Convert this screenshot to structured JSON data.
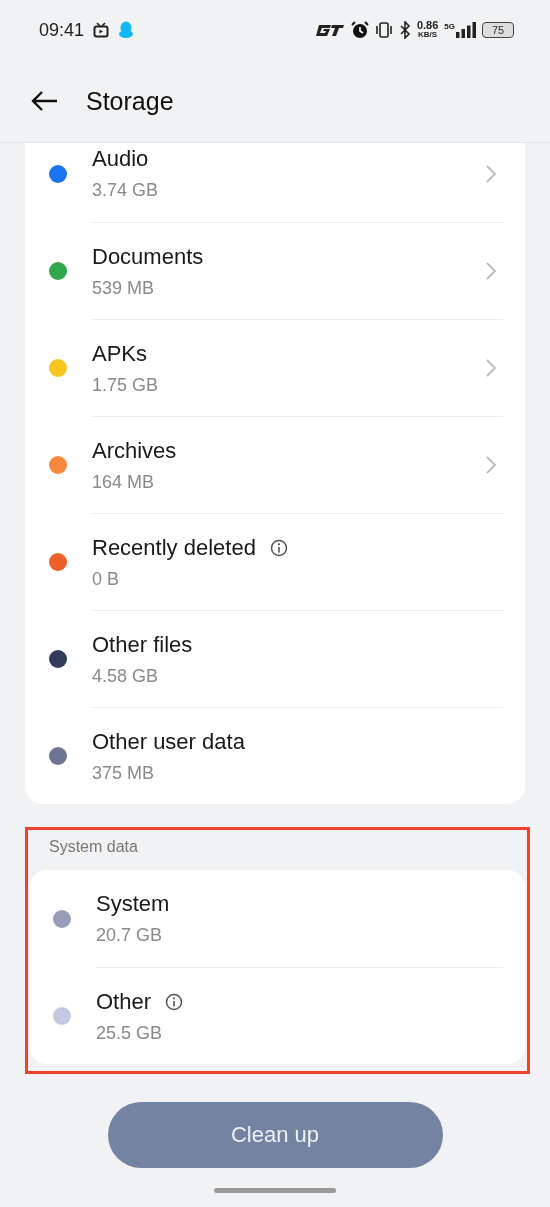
{
  "status_bar": {
    "time": "09:41",
    "network_speed": "0.86",
    "speed_unit": "KB/S",
    "network_type": "5G",
    "battery": "75"
  },
  "header": {
    "title": "Storage"
  },
  "sections": [
    {
      "highlighted": false,
      "items": [
        {
          "name": "Audio",
          "size": "3.74 GB",
          "color": "#1a73f0",
          "chevron": true,
          "info": false
        },
        {
          "name": "Documents",
          "size": "539 MB",
          "color": "#2ea84a",
          "chevron": true,
          "info": false
        },
        {
          "name": "APKs",
          "size": "1.75 GB",
          "color": "#f8c61c",
          "chevron": true,
          "info": false
        },
        {
          "name": "Archives",
          "size": "164 MB",
          "color": "#f5883a",
          "chevron": true,
          "info": false
        },
        {
          "name": "Recently deleted",
          "size": "0 B",
          "color": "#ee5f2a",
          "chevron": false,
          "info": true
        },
        {
          "name": "Other files",
          "size": "4.58 GB",
          "color": "#323b5c",
          "chevron": false,
          "info": false
        },
        {
          "name": "Other user data",
          "size": "375 MB",
          "color": "#6e7590",
          "chevron": false,
          "info": false
        }
      ]
    },
    {
      "label": "System data",
      "highlighted": true,
      "items": [
        {
          "name": "System",
          "size": "20.7 GB",
          "color": "#9a9db8",
          "chevron": false,
          "info": false
        },
        {
          "name": "Other",
          "size": "25.5 GB",
          "color": "#c5c8de",
          "chevron": false,
          "info": true
        }
      ]
    }
  ],
  "action_button": {
    "label": "Clean up"
  }
}
